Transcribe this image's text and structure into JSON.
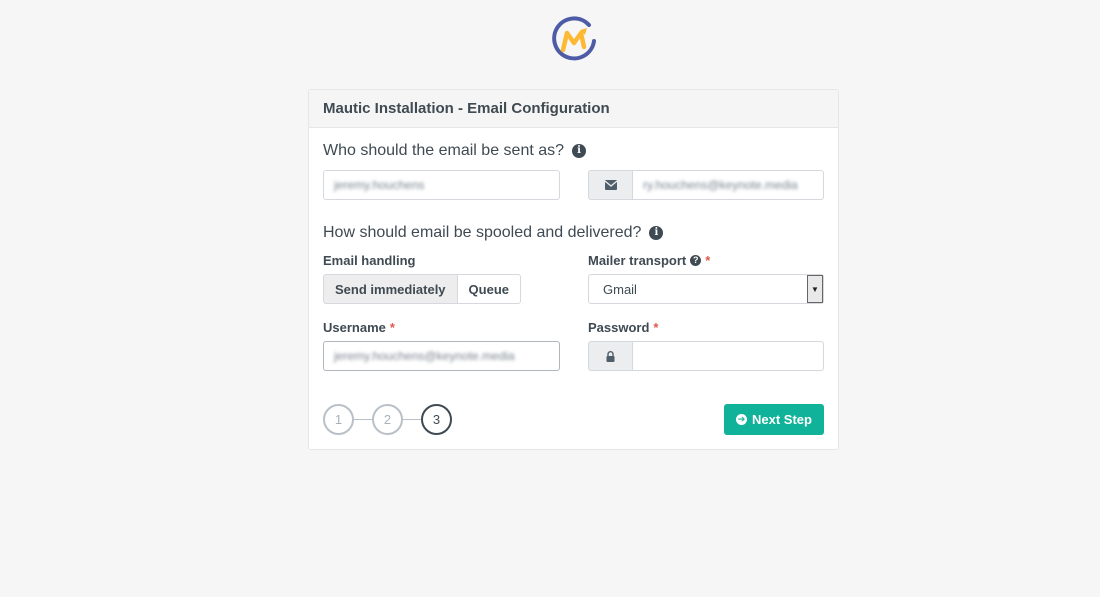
{
  "panel": {
    "title": "Mautic Installation - Email Configuration"
  },
  "sender": {
    "question": "Who should the email be sent as?",
    "name_value": "jeremy.houchens",
    "email_value": "ry.houchens@keynote.media"
  },
  "delivery": {
    "question": "How should email be spooled and delivered?",
    "handling_label": "Email handling",
    "handling_options": [
      "Send immediately",
      "Queue"
    ],
    "transport_label": "Mailer transport",
    "transport_value": "Gmail",
    "required_mark": "*"
  },
  "credentials": {
    "username_label": "Username",
    "username_value": "jeremy.houchens@keynote.media",
    "password_label": "Password",
    "password_value": ""
  },
  "steps": [
    "1",
    "2",
    "3"
  ],
  "next_button": {
    "label": "Next Step"
  },
  "colors": {
    "accent": "#10b29a",
    "required": "#e2574c",
    "logo_ring": "#4e5ba6",
    "logo_m": "#fdb933"
  },
  "icons": [
    "mautic-logo",
    "info-icon",
    "envelope-icon",
    "help-icon",
    "lock-icon",
    "arrow-circle-right-icon"
  ]
}
